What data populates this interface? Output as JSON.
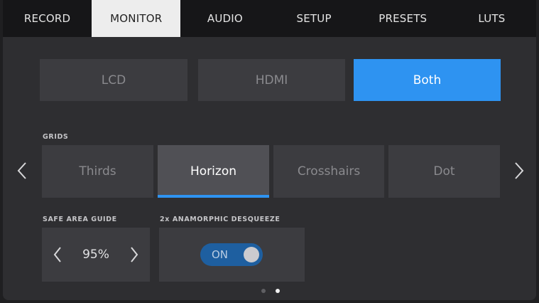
{
  "tabs": [
    {
      "label": "RECORD"
    },
    {
      "label": "MONITOR"
    },
    {
      "label": "AUDIO"
    },
    {
      "label": "SETUP"
    },
    {
      "label": "PRESETS"
    },
    {
      "label": "LUTS"
    }
  ],
  "active_tab": "MONITOR",
  "output": {
    "options": [
      {
        "label": "LCD"
      },
      {
        "label": "HDMI"
      },
      {
        "label": "Both"
      }
    ],
    "selected": "Both"
  },
  "grids": {
    "label": "GRIDS",
    "options": [
      {
        "label": "Thirds"
      },
      {
        "label": "Horizon"
      },
      {
        "label": "Crosshairs"
      },
      {
        "label": "Dot"
      }
    ],
    "selected": "Horizon"
  },
  "safe_area": {
    "label": "SAFE AREA GUIDE",
    "value": "95%"
  },
  "anamorphic": {
    "label": "2x ANAMORPHIC DESQUEEZE",
    "toggle_text": "ON",
    "state": "on"
  },
  "pagination": {
    "pages": 2,
    "current": 2
  },
  "colors": {
    "accent": "#2e93f1",
    "background": "#2e2e31",
    "tab_bar": "#161618"
  },
  "icons": [
    "chevron-left-icon",
    "chevron-right-icon"
  ]
}
